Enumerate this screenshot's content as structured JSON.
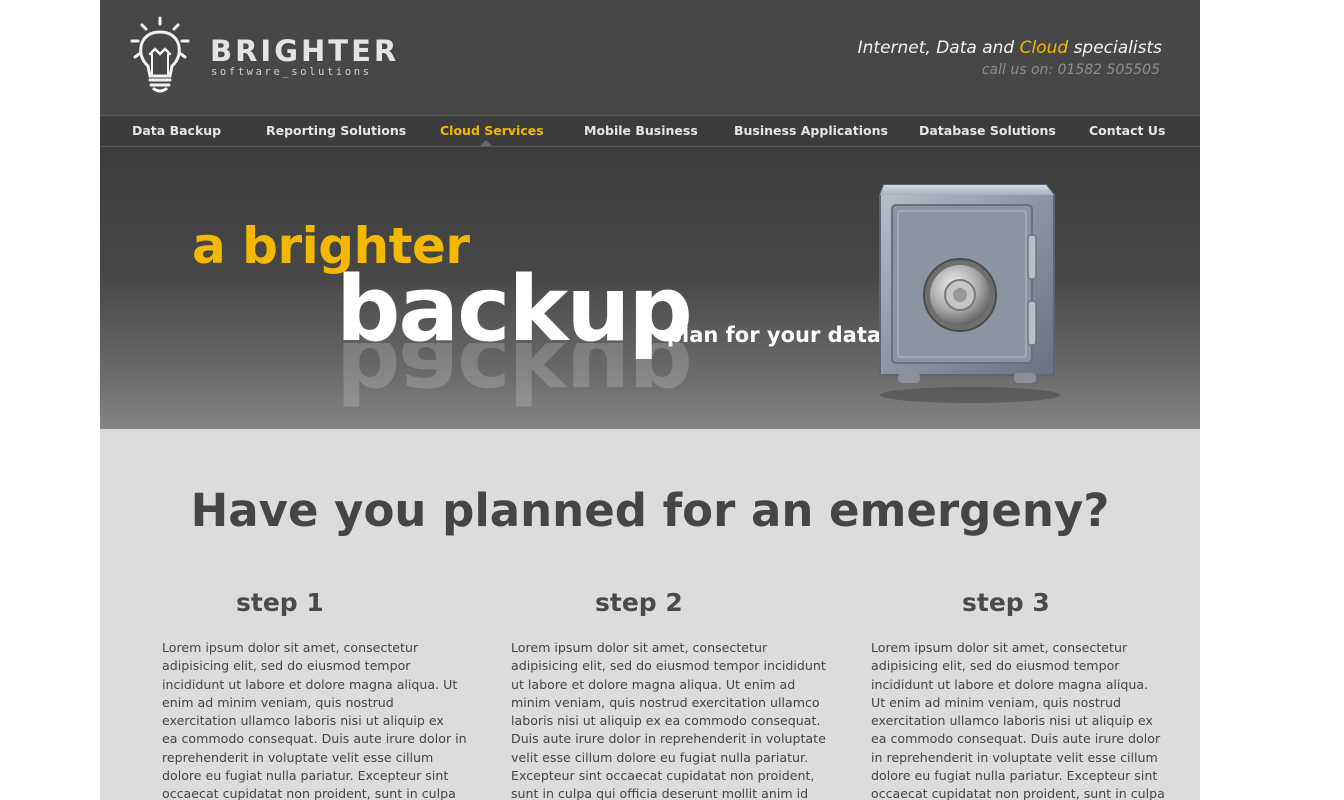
{
  "brand": {
    "name": "BRIGHTER",
    "subtitle": "software_solutions",
    "logo_icon": "lightbulb-icon"
  },
  "header": {
    "tagline_before": "Internet, Data and ",
    "tagline_accent": "Cloud",
    "tagline_after": " specialists",
    "phone": "call us on: 01582 505505"
  },
  "nav": {
    "items": [
      {
        "label": "Data Backup"
      },
      {
        "label": "Reporting Solutions"
      },
      {
        "label": "Cloud Services",
        "active": true
      },
      {
        "label": "Mobile Business"
      },
      {
        "label": "Business Applications"
      },
      {
        "label": "Database Solutions"
      },
      {
        "label": "Contact Us"
      }
    ]
  },
  "hero": {
    "line1": "a brighter",
    "word": "backup",
    "suffix": "plan for your data",
    "image_icon": "safe-icon"
  },
  "content": {
    "headline": "Have you planned for an emergeny?",
    "steps": [
      {
        "title": "step 1",
        "lines": [
          "Lorem ipsum dolor sit amet, consectetur",
          "adipisicing elit, sed do eiusmod tempor",
          "incididunt ut labore et dolore magna aliqua. Ut",
          "enim ad minim veniam, quis nostrud",
          "exercitation ullamco laboris nisi ut aliquip ex",
          "ea commodo consequat. Duis aute irure dolor in",
          "reprehenderit in voluptate velit esse cillum",
          "dolore eu fugiat nulla pariatur. Excepteur sint",
          "occaecat cupidatat non proident, sunt in culpa"
        ]
      },
      {
        "title": "step 2",
        "lines": [
          "Lorem ipsum dolor sit amet, consectetur",
          "adipisicing elit, sed do eiusmod tempor incididunt",
          "ut labore et dolore magna aliqua. Ut enim ad",
          "minim veniam, quis nostrud exercitation ullamco",
          "laboris nisi ut aliquip ex ea commodo consequat.",
          "Duis aute irure dolor in reprehenderit in voluptate",
          "velit esse cillum dolore eu fugiat nulla pariatur.",
          "Excepteur sint occaecat cupidatat non proident,",
          "sunt in culpa qui officia deserunt mollit anim id"
        ]
      },
      {
        "title": "step 3",
        "lines": [
          "Lorem ipsum dolor sit amet, consectetur",
          "adipisicing elit, sed do eiusmod tempor",
          "incididunt ut labore et dolore magna aliqua.",
          "Ut enim ad minim veniam, quis nostrud",
          "exercitation ullamco laboris nisi ut aliquip ex",
          "ea commodo consequat. Duis aute irure dolor",
          "in reprehenderit in voluptate velit esse cillum",
          "dolore eu fugiat nulla pariatur. Excepteur sint",
          "occaecat cupidatat non proident, sunt in culpa"
        ]
      }
    ]
  },
  "colors": {
    "accent": "#f5b800",
    "header_bg": "#474747",
    "content_bg": "#dcdcdc",
    "text_dark": "#454545"
  }
}
